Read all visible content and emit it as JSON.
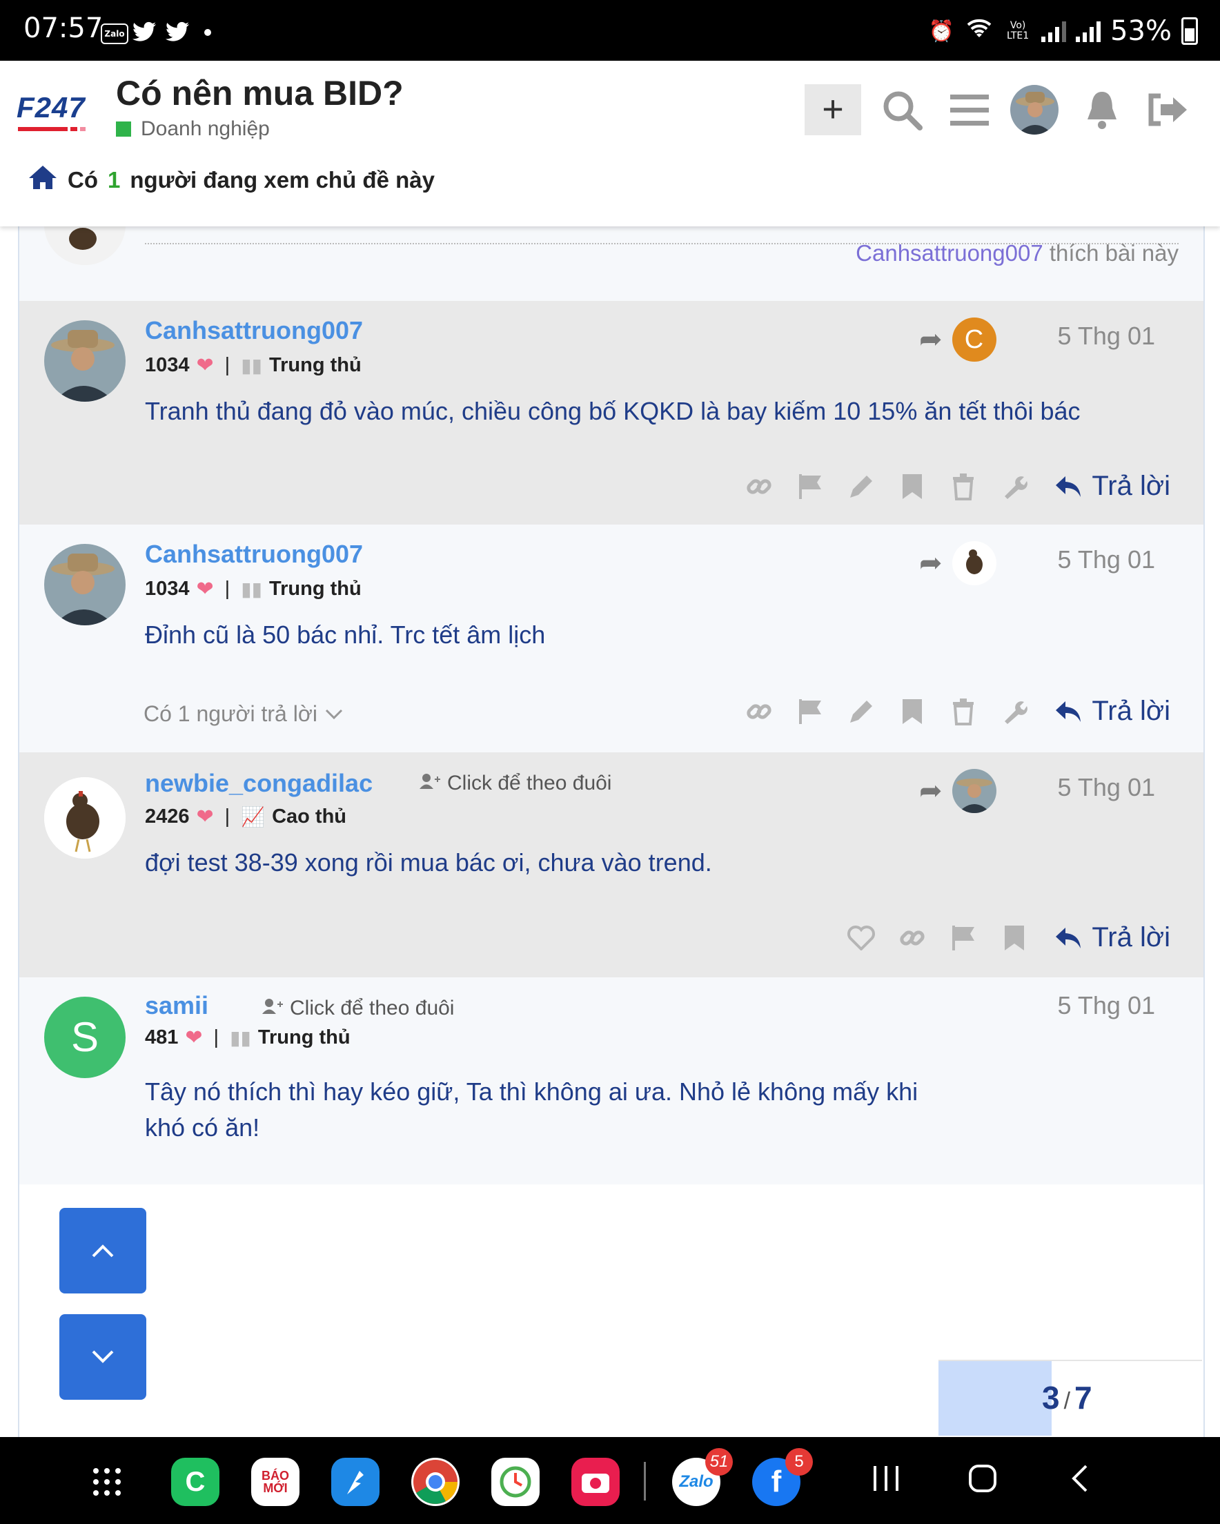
{
  "status_bar": {
    "time": "07:57",
    "zalo": "Zalo",
    "network": "Vo) LTE1",
    "battery": "53%"
  },
  "header": {
    "logo": "F247",
    "title": "Có nên mua BID?",
    "category": "Doanh nghiệp",
    "viewers_prefix": "Có",
    "viewers_count": "1",
    "viewers_suffix": "người đang xem chủ đề này",
    "icons": [
      "plus-icon",
      "search-icon",
      "hamburger-icon",
      "avatar",
      "bell-icon",
      "logout-icon"
    ]
  },
  "previous_post": {
    "liker": "Canhsattruong007",
    "likes_text": "thích bài này"
  },
  "posts": [
    {
      "username": "Canhsattruong007",
      "likes": "1034",
      "rank": "Trung thủ",
      "date": "5 Thg 01",
      "reply_to_initial": "C",
      "body": "Tranh thủ đang đỏ vào múc, chiều công bố KQKD là bay kiếm 10 15% ăn tết thôi bác",
      "reply_label": "Trả lời"
    },
    {
      "username": "Canhsattruong007",
      "likes": "1034",
      "rank": "Trung thủ",
      "date": "5 Thg 01",
      "body": "Đỉnh cũ là 50 bác nhỉ. Trc tết âm lịch",
      "replies_text": "Có 1 người trả lời",
      "reply_label": "Trả lời"
    },
    {
      "username": "newbie_congadilac",
      "follow": "Click để theo đuôi",
      "likes": "2426",
      "rank": "Cao thủ",
      "date": "5 Thg 01",
      "body": "đợi test 38-39 xong rồi mua bác ơi, chưa vào trend.",
      "reply_label": "Trả lời"
    },
    {
      "username": "samii",
      "avatar_letter": "S",
      "follow": "Click để theo đuôi",
      "likes": "481",
      "rank": "Trung thủ",
      "date": "5 Thg 01",
      "body": "Tây nó thích thì hay kéo giữ, Ta thì không ai ưa. Nhỏ lẻ không mấy khi khó có ăn!"
    }
  ],
  "progress": {
    "current": "3",
    "total": "7",
    "fraction": 0.43
  },
  "navbar": {
    "apps": [
      {
        "name": "apps-grid",
        "label": ""
      },
      {
        "name": "phone-app",
        "label": "C"
      },
      {
        "name": "baomoi-app",
        "label": "BÁO MỚI"
      },
      {
        "name": "fireant-app",
        "label": ""
      },
      {
        "name": "chrome-app",
        "label": ""
      },
      {
        "name": "clock-app",
        "label": ""
      },
      {
        "name": "camera-app",
        "label": ""
      },
      {
        "name": "zalo-app",
        "label": "Zalo",
        "badge": "51"
      },
      {
        "name": "facebook-app",
        "label": "f",
        "badge": "5"
      }
    ],
    "accent_colors": {
      "link": "#4a90e2",
      "body": "#1f3c88",
      "button": "#2e6fd8"
    }
  }
}
